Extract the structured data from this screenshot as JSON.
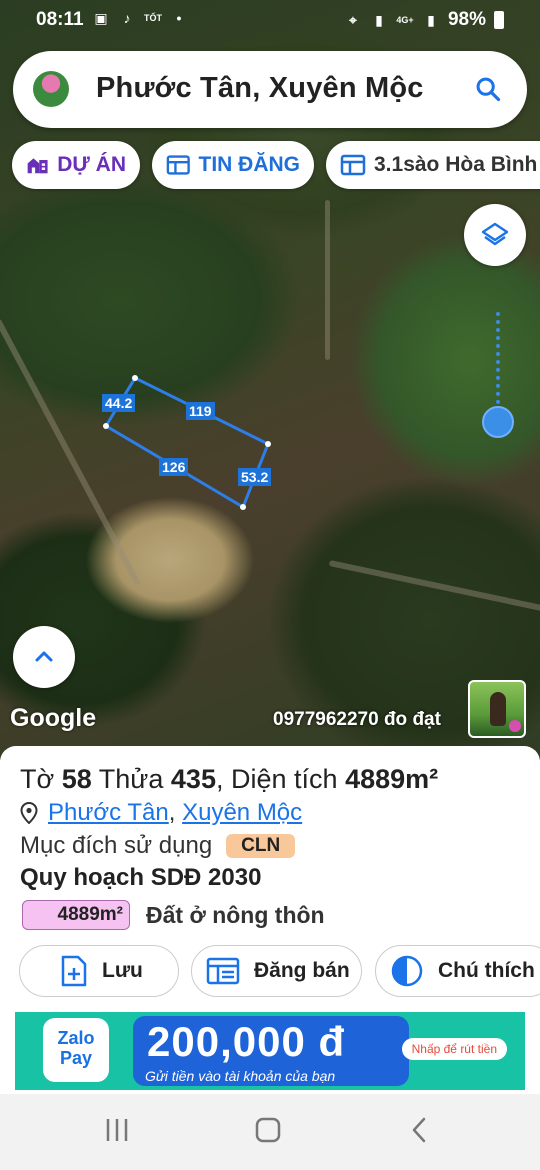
{
  "status": {
    "time": "08:11",
    "left_icons": [
      "image-icon",
      "tiktok-icon",
      "tot-icon",
      "dot-icon"
    ],
    "battery": "98%",
    "right_icons": [
      "location-icon",
      "signal-icon",
      "4g-signal-icon",
      "signal-icon",
      "battery-icon"
    ]
  },
  "search": {
    "query": "Phước Tân, Xuyên Mộc"
  },
  "chips": [
    {
      "label": "DỰ ÁN",
      "icon": "building-icon",
      "color": "#6a2fb8"
    },
    {
      "label": "TIN ĐĂNG",
      "icon": "listing-icon",
      "color": "#1e6fd9"
    },
    {
      "label": "3.1sào Hòa Bình",
      "icon": "listing-icon",
      "color": "#333333"
    }
  ],
  "map": {
    "google_label": "Google",
    "phone_label": "0977962270 đo đạt",
    "parcel_labels": [
      "44.2",
      "119",
      "126",
      "53.2"
    ],
    "parcel_color": "#1e73d8"
  },
  "sheet": {
    "to_label": "Tờ",
    "to_value": "58",
    "thua_label": "Thửa",
    "thua_value": "435",
    "area_label": "Diện tích",
    "area_value": "4889m²",
    "ward": "Phước Tân",
    "district": "Xuyên Mộc",
    "purpose_label": "Mục đích sử dụng",
    "purpose_code": "CLN",
    "plan_title": "Quy hoạch SDĐ 2030",
    "plan_area": "4889m²",
    "plan_type": "Đất ở nông thôn"
  },
  "actions": {
    "save": "Lưu",
    "sell": "Đăng bán",
    "legend": "Chú thích"
  },
  "ad": {
    "brand_line1": "Zalo",
    "brand_line2": "Pay",
    "amount": "200,000 đ",
    "subtitle": "Gửi tiền vào tài khoản của bạn",
    "cta": "Nhấp để rút tiền"
  }
}
